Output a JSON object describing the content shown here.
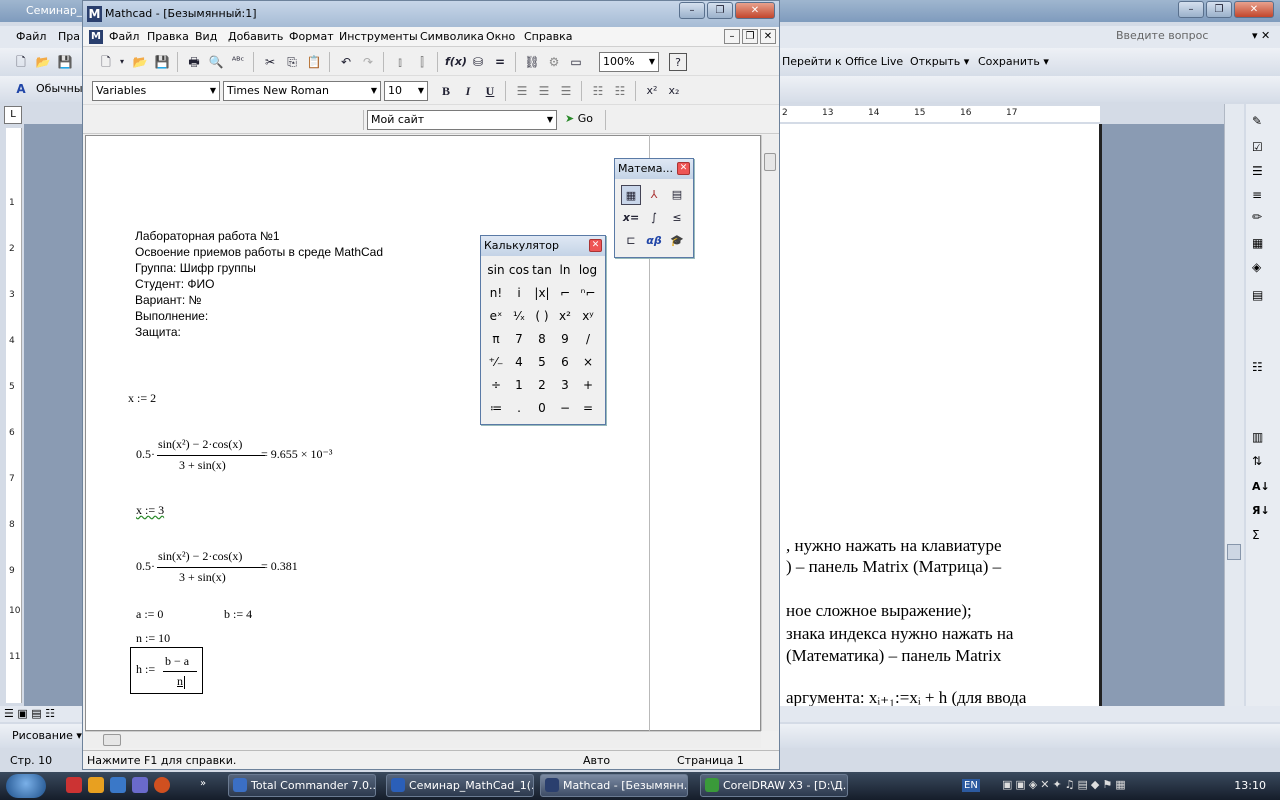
{
  "word": {
    "title": "Семинар_Ма",
    "menu": [
      "Файл",
      "Пра"
    ],
    "ask_placeholder": "Введите вопрос",
    "toolbar": {
      "office_live": "Перейти к Office Live",
      "open": "Открыть",
      "save": "Сохранить",
      "style": "Обычный"
    },
    "ruler_h": [
      "2",
      "13",
      "14",
      "15",
      "16",
      "17"
    ],
    "ruler_v": [
      "1",
      "2",
      "3",
      "4",
      "5",
      "6",
      "7",
      "8",
      "9",
      "10",
      "11"
    ],
    "doc_lines": [
      ", нужно нажать на клавиатуре",
      ") – панель Matrix (Матрица) –",
      "ное сложное выражение);",
      "знака индекса нужно нажать на",
      "(Математика) – панель Matrix",
      "аргумента: xᵢ₊₁:=xᵢ + h (для ввода"
    ],
    "draw_label": "Рисование",
    "status_page": "Стр. 10"
  },
  "mathcad": {
    "title": "Mathcad - [Безымянный:1]",
    "menu": [
      "Файл",
      "Правка",
      "Вид",
      "Добавить",
      "Формат",
      "Инструменты",
      "Символика",
      "Окно",
      "Справка"
    ],
    "zoom": "100%",
    "style_combo": "Variables",
    "font_combo": "Times New Roman",
    "size_combo": "10",
    "site_combo": "Мой сайт",
    "go_label": "Go",
    "status": {
      "help": "Нажмите F1 для справки.",
      "mode": "Авто",
      "page": "Страница 1"
    },
    "header_lines": [
      "Лабораторная работа №1",
      "Освоение приемов работы в среде MathCad",
      "Группа: Шифр группы",
      "Студент: ФИО",
      "Вариант: №",
      "Выполнение:",
      "Защита:"
    ],
    "expr": {
      "x1": "x := 2",
      "coef": "0.5·",
      "numerator": "sin(x²) − 2·cos(x)",
      "denominator": "3 + sin(x)",
      "result1": "= 9.655 × 10⁻³",
      "x2": "x := 3",
      "result2": "= 0.381",
      "a": "a := 0",
      "b": "b := 4",
      "n": "n := 10",
      "h_lhs": "h :=",
      "h_num": "b − a",
      "h_den": "n"
    }
  },
  "calculator": {
    "title": "Калькулятор",
    "keys": [
      [
        "sin",
        "cos",
        "tan",
        "ln",
        "log"
      ],
      [
        "n!",
        "i",
        "|x|",
        "⌐",
        "ⁿ⌐"
      ],
      [
        "eˣ",
        "¹⁄ₓ",
        "( )",
        "x²",
        "xʸ"
      ],
      [
        "π",
        "7",
        "8",
        "9",
        "/"
      ],
      [
        "⁺⁄₋",
        "4",
        "5",
        "6",
        "×"
      ],
      [
        "÷",
        "1",
        "2",
        "3",
        "+"
      ],
      [
        "≔",
        ".",
        "0",
        "−",
        "="
      ]
    ]
  },
  "math_palette": {
    "title": "Матема...",
    "buttons": [
      "calculator",
      "graph",
      "matrix",
      "evaluation",
      "calculus",
      "boolean",
      "programming",
      "greek",
      "symbolic"
    ]
  },
  "taskbar": {
    "tasks": [
      {
        "label": "Total Commander 7.0...",
        "color": "#3b6fc4"
      },
      {
        "label": "Семинар_MathCad_1(...",
        "color": "#2b5fb8"
      },
      {
        "label": "Mathcad - [Безымянн...",
        "color": "#2a3f6e"
      },
      {
        "label": "CorelDRAW X3 - [D:\\Д...",
        "color": "#3a9a3a"
      }
    ],
    "lang": "EN",
    "clock": "13:10"
  }
}
